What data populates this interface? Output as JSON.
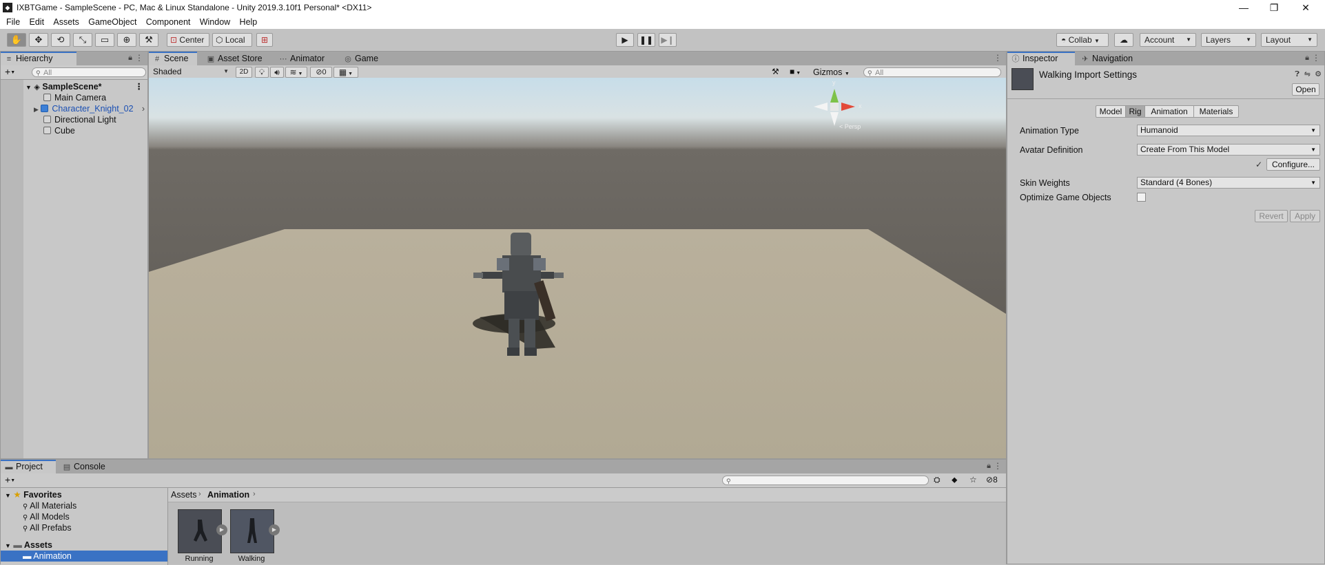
{
  "window": {
    "title": "IXBTGame - SampleScene - PC, Mac & Linux Standalone - Unity 2019.3.10f1 Personal* <DX11>",
    "minimize": "—",
    "maximize": "❐",
    "close": "✕"
  },
  "menu": [
    "File",
    "Edit",
    "Assets",
    "GameObject",
    "Component",
    "Window",
    "Help"
  ],
  "toolbar": {
    "pivot_center": "Center",
    "pivot_local": "Local",
    "collab": "Collab",
    "account": "Account",
    "layers": "Layers",
    "layout": "Layout"
  },
  "hierarchy": {
    "tab": "Hierarchy",
    "search_placeholder": "All",
    "scene": "SampleScene*",
    "items": [
      "Main Camera",
      "Character_Knight_02",
      "Directional Light",
      "Cube"
    ]
  },
  "scene_tabs": [
    "Scene",
    "Asset Store",
    "Animator",
    "Game"
  ],
  "scene_bar": {
    "shading": "Shaded",
    "mode_2d": "2D",
    "hidden_count": "0",
    "gizmos": "Gizmos",
    "search_placeholder": "All"
  },
  "gizmo_labels": {
    "y": "y",
    "x": "x",
    "persp": "< Persp"
  },
  "inspector": {
    "tab": "Inspector",
    "tab2": "Navigation",
    "asset_title": "Walking Import Settings",
    "open": "Open",
    "subtabs": [
      "Model",
      "Rig",
      "Animation",
      "Materials"
    ],
    "active_subtab": "Rig",
    "fields": {
      "animation_type_label": "Animation Type",
      "animation_type_value": "Humanoid",
      "avatar_def_label": "Avatar Definition",
      "avatar_def_value": "Create From This Model",
      "configure": "Configure...",
      "check": "✓",
      "skin_weights_label": "Skin Weights",
      "skin_weights_value": "Standard (4 Bones)",
      "optimize_label": "Optimize Game Objects",
      "optimize_checked": false
    },
    "revert": "Revert",
    "apply": "Apply"
  },
  "project": {
    "tabs": [
      "Project",
      "Console"
    ],
    "breadcrumb": [
      "Assets",
      "Animation"
    ],
    "hidden_count": "8",
    "favorites_label": "Favorites",
    "favorites": [
      "All Materials",
      "All Models",
      "All Prefabs"
    ],
    "assets_label": "Assets",
    "selected_folder": "Animation",
    "files": [
      "Running",
      "Walking"
    ]
  },
  "colors": {
    "accent_blue": "#3a72c4",
    "selected_folder_bg": "#3a72c4",
    "sky_top": "#c9dde8",
    "ground": "#b5ad9a"
  }
}
